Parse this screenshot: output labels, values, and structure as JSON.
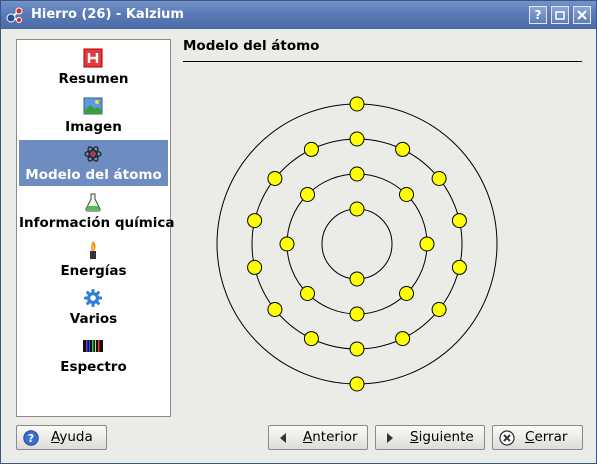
{
  "window": {
    "title": "Hierro (26) - Kalzium",
    "buttons": {
      "help": "?",
      "minimize": "_",
      "close": "×"
    }
  },
  "sidebar": {
    "items": [
      {
        "label": "Resumen",
        "icon": "summary-h-icon",
        "selected": false
      },
      {
        "label": "Imagen",
        "icon": "image-icon",
        "selected": false
      },
      {
        "label": "Modelo del átomo",
        "icon": "atom-icon",
        "selected": true
      },
      {
        "label": "Información química",
        "icon": "flask-icon",
        "selected": false
      },
      {
        "label": "Energías",
        "icon": "flame-icon",
        "selected": false
      },
      {
        "label": "Varios",
        "icon": "gear-icon",
        "selected": false
      },
      {
        "label": "Espectro",
        "icon": "spectrum-icon",
        "selected": false
      }
    ]
  },
  "main": {
    "heading": "Modelo del átomo",
    "atom_model": {
      "shells": [
        2,
        8,
        14,
        2
      ],
      "electron_color": "#ffff00"
    }
  },
  "footer": {
    "help_label": "Ayuda",
    "previous_label": "Anterior",
    "next_label": "Siguiente",
    "close_label": "Cerrar"
  },
  "colors": {
    "titlebar": "#5a7bb6",
    "selection": "#6d8cc0",
    "window_bg": "#ebebe7"
  }
}
